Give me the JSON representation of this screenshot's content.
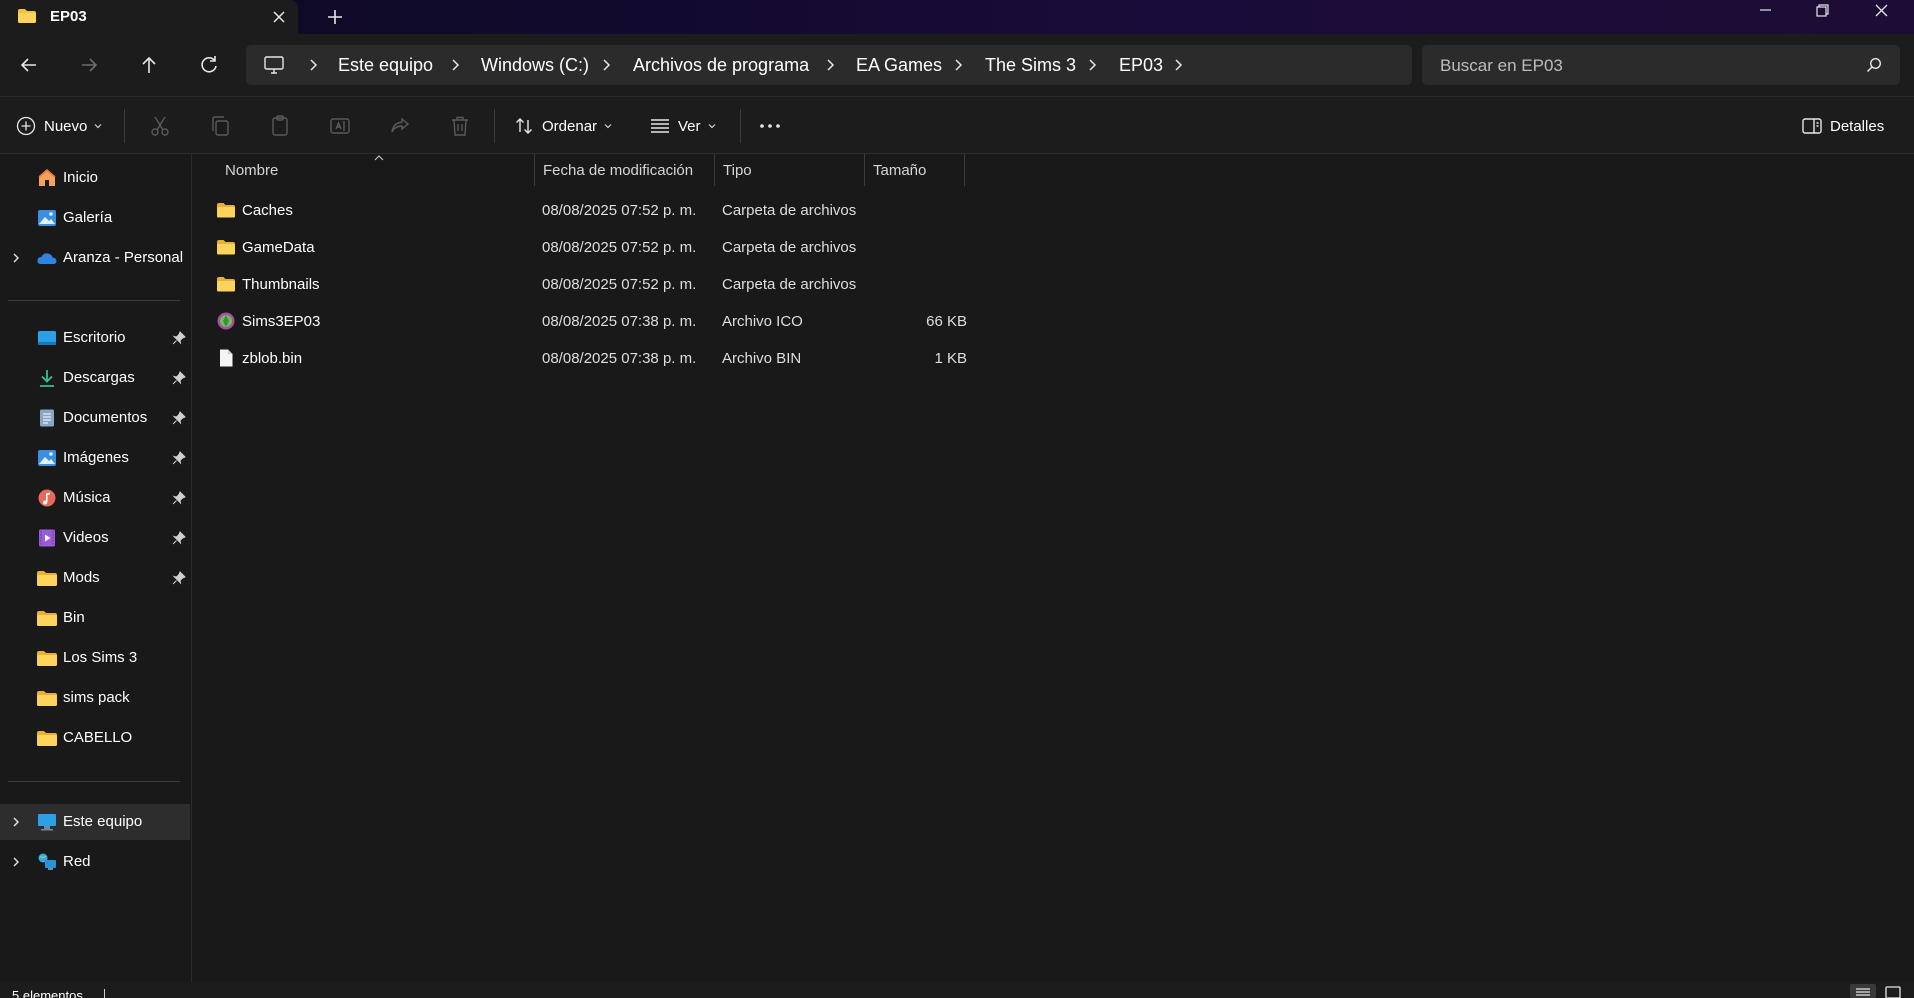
{
  "window": {
    "tab_title": "EP03"
  },
  "address": {
    "breadcrumbs": [
      "Este equipo",
      "Windows (C:)",
      "Archivos de programa",
      "EA Games",
      "The Sims 3",
      "EP03"
    ],
    "search_placeholder": "Buscar en EP03"
  },
  "toolbar": {
    "new_label": "Nuevo",
    "sort_label": "Ordenar",
    "view_label": "Ver",
    "details_label": "Detalles"
  },
  "sidebar": {
    "top_items": [
      {
        "label": "Inicio",
        "icon": "home-icon"
      },
      {
        "label": "Galería",
        "icon": "gallery-icon"
      },
      {
        "label": "Aranza - Personal",
        "icon": "onedrive-cloud-icon"
      }
    ],
    "pinned_items": [
      {
        "label": "Escritorio",
        "icon": "desktop-icon"
      },
      {
        "label": "Descargas",
        "icon": "download-icon"
      },
      {
        "label": "Documentos",
        "icon": "documents-icon"
      },
      {
        "label": "Imágenes",
        "icon": "pictures-icon"
      },
      {
        "label": "Música",
        "icon": "music-icon"
      },
      {
        "label": "Videos",
        "icon": "videos-icon"
      },
      {
        "label": "Mods",
        "icon": "folder-icon"
      }
    ],
    "folder_items": [
      {
        "label": "Bin",
        "icon": "folder-icon"
      },
      {
        "label": "Los Sims 3",
        "icon": "folder-icon"
      },
      {
        "label": "sims pack",
        "icon": "folder-icon"
      },
      {
        "label": "CABELLO",
        "icon": "folder-icon"
      }
    ],
    "bottom_items": [
      {
        "label": "Este equipo",
        "icon": "computer-icon"
      },
      {
        "label": "Red",
        "icon": "network-icon"
      }
    ]
  },
  "file_list": {
    "columns": [
      "Nombre",
      "Fecha de modificación",
      "Tipo",
      "Tamaño"
    ],
    "rows": [
      {
        "name": "Caches",
        "modified": "08/08/2025 07:52 p. m.",
        "type": "Carpeta de archivos",
        "size": "",
        "icon": "folder-icon"
      },
      {
        "name": "GameData",
        "modified": "08/08/2025 07:52 p. m.",
        "type": "Carpeta de archivos",
        "size": "",
        "icon": "folder-icon"
      },
      {
        "name": "Thumbnails",
        "modified": "08/08/2025 07:52 p. m.",
        "type": "Carpeta de archivos",
        "size": "",
        "icon": "folder-icon"
      },
      {
        "name": "Sims3EP03",
        "modified": "08/08/2025 07:38 p. m.",
        "type": "Archivo ICO",
        "size": "66 KB",
        "icon": "sims-plumbob-icon"
      },
      {
        "name": "zblob.bin",
        "modified": "08/08/2025 07:38 p. m.",
        "type": "Archivo BIN",
        "size": "1 KB",
        "icon": "blank-file-icon"
      }
    ]
  },
  "status": {
    "item_count": "5 elementos"
  },
  "colors": {
    "background": "#191919",
    "panel": "#1c1c1c",
    "field": "#2b2b2b",
    "folder_yellow": "#f8c43a",
    "accent_blue": "#4aa8ee"
  }
}
